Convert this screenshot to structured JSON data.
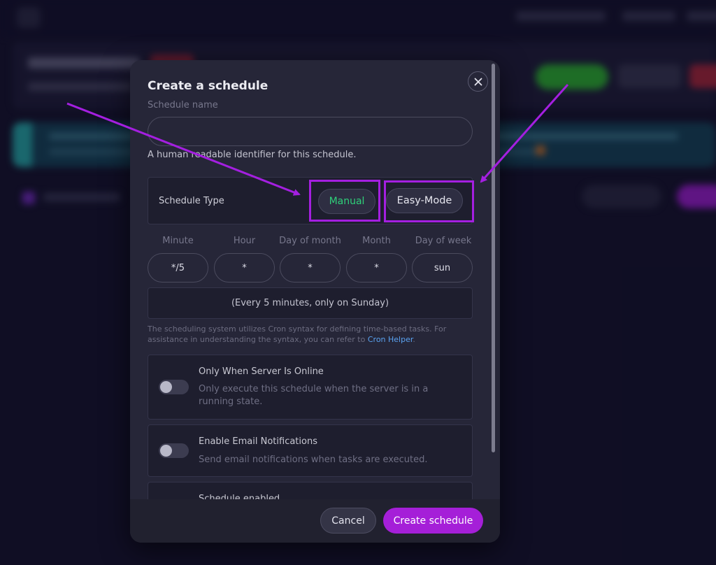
{
  "colors": {
    "accent": "#a51fd8",
    "highlight": "#a41fe0",
    "manual_active": "#2fd07a",
    "link": "#5aa2f0"
  },
  "modal": {
    "title": "Create a schedule",
    "close_icon": "close-icon",
    "name_label": "Schedule name",
    "name_value": "",
    "name_placeholder": "",
    "name_helper": "A human readable identifier for this schedule.",
    "schedule_type": {
      "label": "Schedule Type",
      "options": [
        "Manual",
        "Easy-Mode"
      ],
      "selected": "Manual"
    },
    "cron": {
      "fields": [
        {
          "label": "Minute",
          "value": "*/5"
        },
        {
          "label": "Hour",
          "value": "*"
        },
        {
          "label": "Day of month",
          "value": "*"
        },
        {
          "label": "Month",
          "value": "*"
        },
        {
          "label": "Day of week",
          "value": "sun"
        }
      ],
      "description": "(Every 5 minutes, only on Sunday)",
      "note": "The scheduling system utilizes Cron syntax for defining time-based tasks. For assistance in understanding the syntax, you can refer to",
      "link_text": "Cron Helper",
      "note_end": "."
    },
    "options": [
      {
        "title": "Only When Server Is Online",
        "description": "Only execute this schedule when the server is in a running state.",
        "enabled": false
      },
      {
        "title": "Enable Email Notifications",
        "description": "Send email notifications when tasks are executed.",
        "enabled": false
      },
      {
        "title": "Schedule enabled"
      }
    ],
    "footer": {
      "cancel_label": "Cancel",
      "create_label": "Create schedule"
    }
  }
}
